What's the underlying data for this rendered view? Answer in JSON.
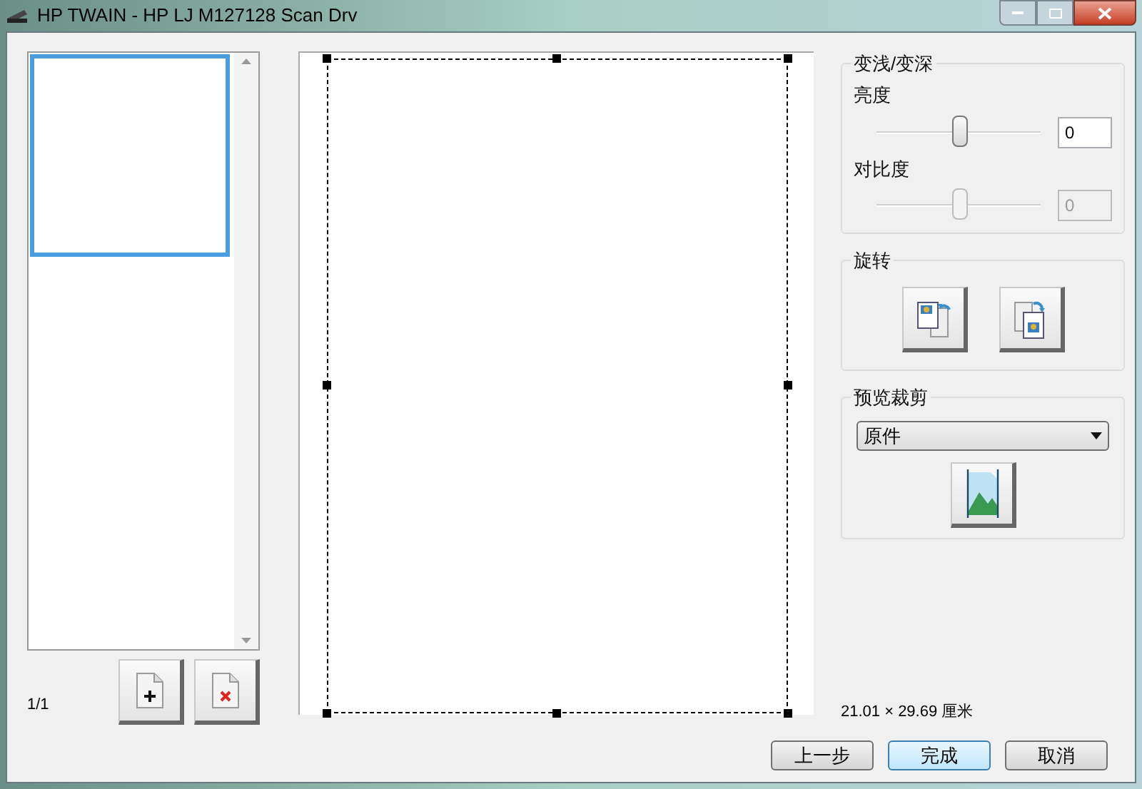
{
  "window": {
    "title": "HP TWAIN - HP LJ M127128 Scan Drv"
  },
  "pages": {
    "thumbnails": [
      {
        "selected": true
      }
    ],
    "counter": "1/1"
  },
  "adjust": {
    "title": "变浅/变深",
    "sliders": [
      {
        "label": "亮度",
        "level": 0.5,
        "value": "0",
        "disabled": false
      },
      {
        "label": "对比度",
        "level": 0.5,
        "value": "0",
        "disabled": true
      }
    ]
  },
  "rotate": {
    "title": "旋转"
  },
  "crop": {
    "title": "预览裁剪",
    "select": "原件"
  },
  "size": "21.01 × 29.69 厘米",
  "buttons": [
    {
      "label": "上一步",
      "default": false
    },
    {
      "label": "完成",
      "default": true
    },
    {
      "label": "取消",
      "default": false
    }
  ]
}
